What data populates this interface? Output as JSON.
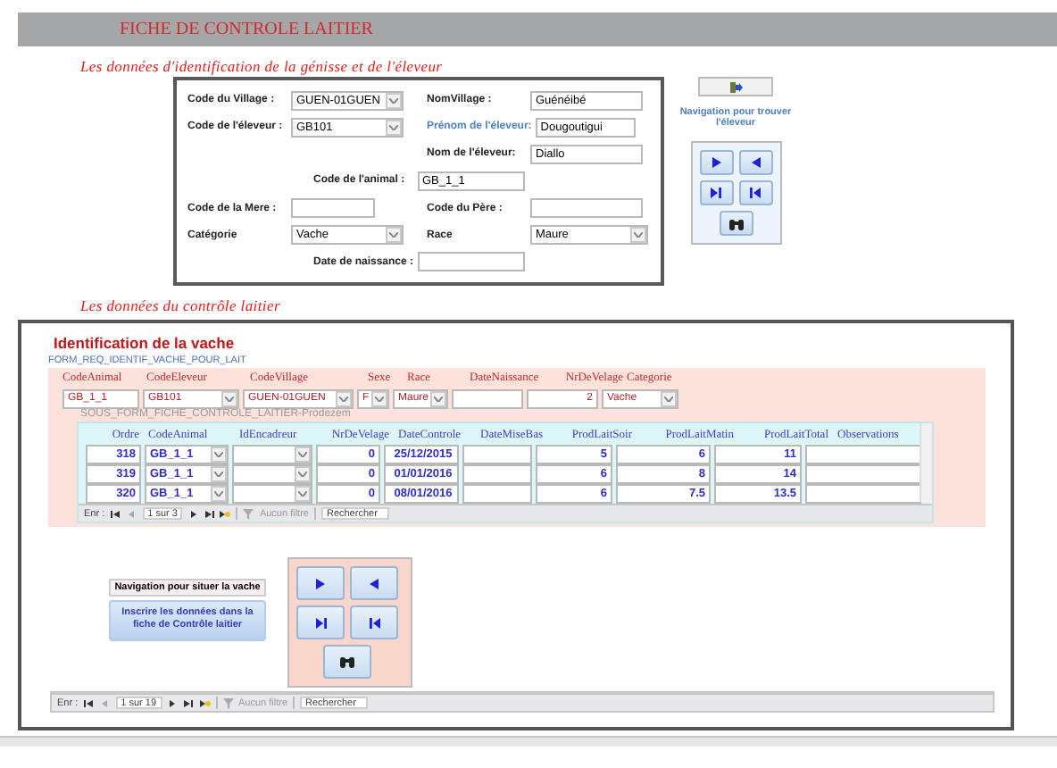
{
  "title_bar": {
    "title": "FICHE DE CONTROLE LAITIER"
  },
  "identification": {
    "heading": "Les données d'identification de la génisse et de l'éleveur",
    "rows": [
      {
        "kind": "pair",
        "fields": [
          {
            "label": "Code du Village :",
            "kind": "combo",
            "value": "GUEN-01GUEN"
          },
          {
            "label": "NomVillage :",
            "kind": "text",
            "value": "Guénéibé"
          }
        ]
      },
      {
        "kind": "pair",
        "fields": [
          {
            "label": "Code de l'éleveur :",
            "kind": "combo",
            "value": "GB101"
          },
          {
            "label": "Prénom de l'éleveur:",
            "kind": "text",
            "value": "Dougoutigui",
            "color": "#4f81bd"
          }
        ]
      },
      {
        "kind": "right",
        "fields": [
          {
            "label": "Nom de l'éleveur:",
            "kind": "text",
            "value": "Diallo"
          }
        ]
      },
      {
        "kind": "center",
        "fields": [
          {
            "label": "Code de l'animal :",
            "kind": "text",
            "value": "GB_1_1"
          }
        ]
      },
      {
        "kind": "pair",
        "fields": [
          {
            "label": "Code de la Mere :",
            "kind": "text"
          },
          {
            "label": "Code du Père :",
            "kind": "text"
          }
        ]
      },
      {
        "kind": "pair",
        "fields": [
          {
            "label": "Catégorie",
            "kind": "combo",
            "value": "Vache"
          },
          {
            "label": "Race",
            "kind": "combo",
            "value": "Maure"
          }
        ]
      },
      {
        "kind": "center",
        "fields": [
          {
            "label": "Date de naissance :",
            "kind": "text"
          }
        ]
      }
    ],
    "nav_caption": "Navigation pour trouver l'éleveur"
  },
  "controle": {
    "heading": "Les données du contrôle laitier",
    "title": "Identification de la vache",
    "form_name": "FORM_REQ_IDENTIF_VACHE_POUR_LAIT",
    "fields": [
      {
        "name": "CodeAnimal",
        "kind": "text",
        "value": "GB_1_1"
      },
      {
        "name": "CodeEleveur",
        "kind": "combo",
        "value": "GB101"
      },
      {
        "name": "CodeVillage",
        "kind": "combo",
        "value": "GUEN-01GUEN"
      },
      {
        "name": "Sexe",
        "kind": "combo",
        "value": "F"
      },
      {
        "name": "Race",
        "kind": "combo",
        "value": "Maure"
      },
      {
        "name": "DateNaissance",
        "kind": "text"
      },
      {
        "name": "NrDeVelage",
        "kind": "num",
        "value": "2"
      },
      {
        "name": "Categorie",
        "kind": "combo",
        "value": "Vache"
      }
    ],
    "subform_name": "SOUS_FORM_FICHE_CONTROLE_LAITIER-Prodezem",
    "subform": {
      "columns": [
        {
          "name": "Ordre",
          "kind": "num"
        },
        {
          "name": "CodeAnimal",
          "kind": "combo"
        },
        {
          "name": "IdEncadreur",
          "kind": "combo"
        },
        {
          "name": "NrDeVelage",
          "kind": "num"
        },
        {
          "name": "DateControle",
          "kind": "date"
        },
        {
          "name": "DateMiseBas",
          "kind": "text"
        },
        {
          "name": "ProdLaitSoir",
          "kind": "num"
        },
        {
          "name": "ProdLaitMatin",
          "kind": "num"
        },
        {
          "name": "ProdLaitTotal",
          "kind": "num"
        },
        {
          "name": "Observations",
          "kind": "text"
        }
      ],
      "rows": [
        [
          {
            "value": "318"
          },
          {
            "value": "GB_1_1"
          },
          {},
          {
            "value": "0"
          },
          {
            "value": "25/12/2015"
          },
          {},
          {
            "value": "5"
          },
          {
            "value": "6"
          },
          {
            "value": "11"
          },
          {}
        ],
        [
          {
            "value": "319"
          },
          {
            "value": "GB_1_1"
          },
          {},
          {
            "value": "0"
          },
          {
            "value": "01/01/2016"
          },
          {},
          {
            "value": "6"
          },
          {
            "value": "8"
          },
          {
            "value": "14"
          },
          {}
        ],
        [
          {
            "value": "320"
          },
          {
            "value": "GB_1_1"
          },
          {},
          {
            "value": "0"
          },
          {
            "value": "08/01/2016"
          },
          {},
          {
            "value": "6"
          },
          {
            "value": "7.5"
          },
          {
            "value": "13.5"
          },
          {}
        ]
      ],
      "nav": {
        "label": "Enr :",
        "position": "1 sur 3",
        "filter": "Aucun filtre",
        "search_placeholder": "Rechercher"
      }
    },
    "nav_caption": "Navigation pour situer la vache",
    "action_button": "Inscrire les données dans la fiche de Contrôle laitier",
    "nav": {
      "label": "Enr :",
      "position": "1 sur 19",
      "filter": "Aucun filtre",
      "search_placeholder": "Rechercher"
    }
  }
}
